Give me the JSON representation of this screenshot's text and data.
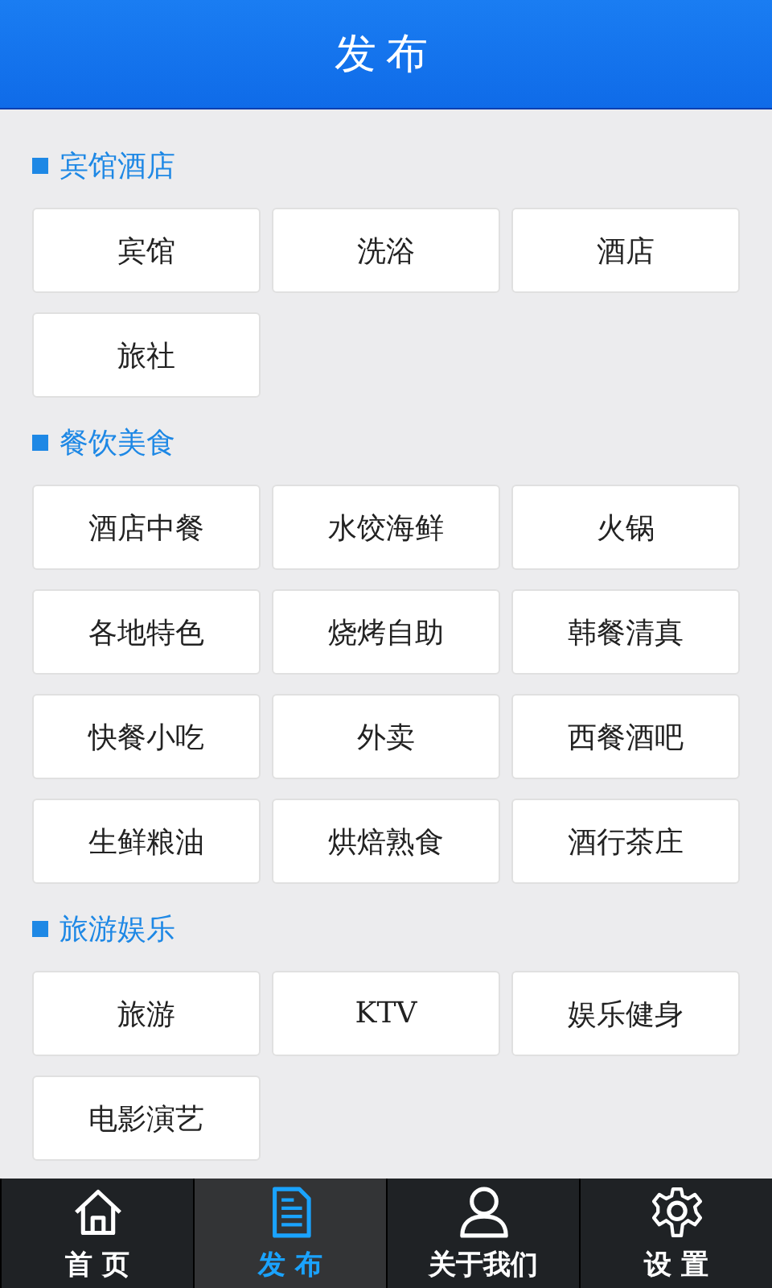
{
  "header": {
    "title": "发布"
  },
  "sections": [
    {
      "title": "宾馆酒店",
      "items": [
        "宾馆",
        "洗浴",
        "酒店",
        "旅社"
      ]
    },
    {
      "title": "餐饮美食",
      "items": [
        "酒店中餐",
        "水饺海鲜",
        "火锅",
        "各地特色",
        "烧烤自助",
        "韩餐清真",
        "快餐小吃",
        "外卖",
        "西餐酒吧",
        "生鲜粮油",
        "烘焙熟食",
        "酒行茶庄"
      ]
    },
    {
      "title": "旅游娱乐",
      "items": [
        "旅游",
        "KTV",
        "娱乐健身",
        "电影演艺"
      ]
    }
  ],
  "tabs": [
    {
      "kind": "home",
      "label": "首 页",
      "selected": false
    },
    {
      "kind": "document",
      "label": "发 布",
      "selected": true
    },
    {
      "kind": "person",
      "label": "关于我们",
      "selected": false
    },
    {
      "kind": "gear",
      "label": "设 置",
      "selected": false
    }
  ]
}
